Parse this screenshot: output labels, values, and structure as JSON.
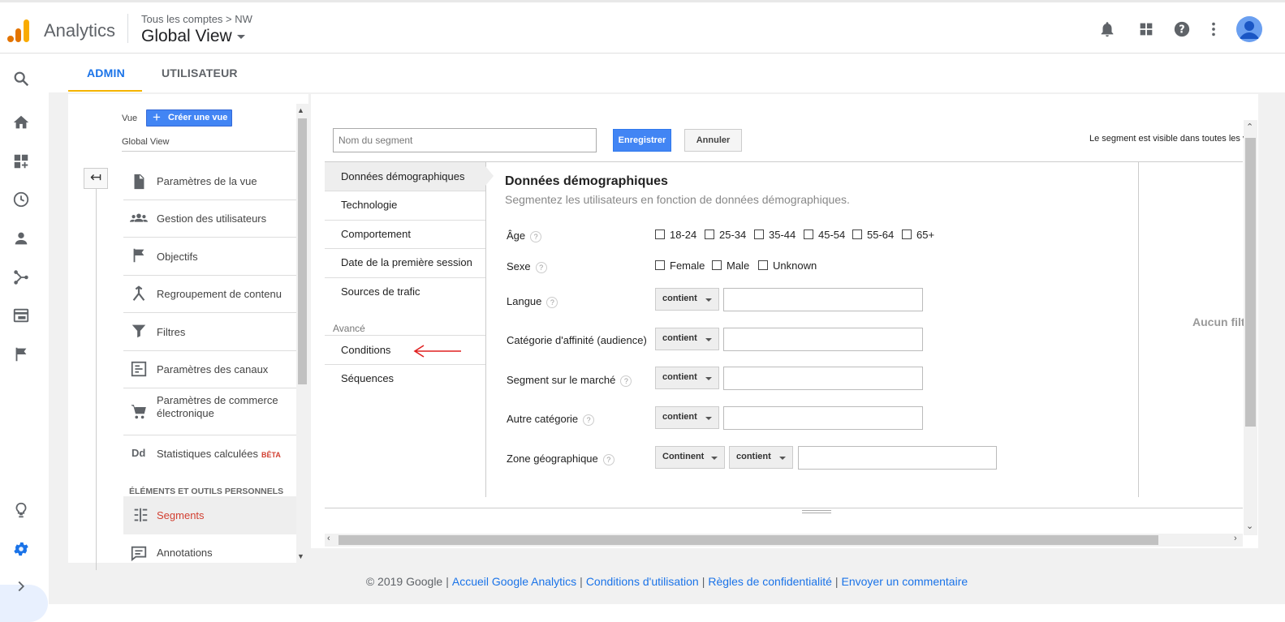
{
  "header": {
    "brand": "Analytics",
    "breadcrumb": "Tous les comptes > NW",
    "view_name": "Global View"
  },
  "tabs": [
    {
      "label": "ADMIN"
    },
    {
      "label": "UTILISATEUR"
    }
  ],
  "admin": {
    "vue_label": "Vue",
    "create_view_label": "Créer une vue",
    "view_name": "Global View",
    "items": [
      {
        "label": "Paramètres de la vue",
        "icon": "document-icon"
      },
      {
        "label": "Gestion des utilisateurs",
        "icon": "people-icon"
      },
      {
        "label": "Objectifs",
        "icon": "flag-icon"
      },
      {
        "label": "Regroupement de contenu",
        "icon": "merge-icon"
      },
      {
        "label": "Filtres",
        "icon": "filter-icon"
      },
      {
        "label": "Paramètres des canaux",
        "icon": "channel-icon"
      },
      {
        "label": "Paramètres de commerce électronique",
        "icon": "cart-icon"
      },
      {
        "label": "Statistiques calculées",
        "badge": "BÊTA",
        "icon": "dd-icon"
      }
    ],
    "section_title": "ÉLÉMENTS ET OUTILS PERSONNELS",
    "personal_items": [
      {
        "label": "Segments",
        "icon": "segments-icon",
        "active": true
      },
      {
        "label": "Annotations",
        "icon": "annotation-icon"
      }
    ]
  },
  "editor": {
    "segment_name_placeholder": "Nom du segment",
    "save_label": "Enregistrer",
    "cancel_label": "Annuler",
    "visibility_note": "Le segment est visible dans toutes les vues",
    "nav": [
      {
        "label": "Données démographiques",
        "selected": true
      },
      {
        "label": "Technologie"
      },
      {
        "label": "Comportement"
      },
      {
        "label": "Date de la première session"
      },
      {
        "label": "Sources de trafic"
      }
    ],
    "advanced_label": "Avancé",
    "advanced_nav": [
      {
        "label": "Conditions"
      },
      {
        "label": "Séquences"
      }
    ],
    "panel_title": "Données démographiques",
    "panel_subtitle": "Segmentez les utilisateurs en fonction de données démographiques.",
    "age_label": "Âge",
    "age_options": [
      "18-24",
      "25-34",
      "35-44",
      "45-54",
      "55-64",
      "65+"
    ],
    "sex_label": "Sexe",
    "sex_options": [
      "Female",
      "Male",
      "Unknown"
    ],
    "langue_label": "Langue",
    "affinity_label": "Catégorie d'affinité (audience)",
    "market_label": "Segment sur le marché",
    "other_label": "Autre catégorie",
    "geo_label": "Zone géographique",
    "contains_label": "contient",
    "continent_label": "Continent",
    "no_filter_text": "Aucun filtre"
  },
  "footer": {
    "copyright": "© 2019 Google",
    "links": [
      "Accueil Google Analytics",
      "Conditions d'utilisation",
      "Règles de confidentialité",
      "Envoyer un commentaire"
    ]
  },
  "colors": {
    "accent": "#1a73e8",
    "tab_underline": "#f4b400",
    "primary_button": "#4285f4",
    "active_item": "#d23f31"
  }
}
